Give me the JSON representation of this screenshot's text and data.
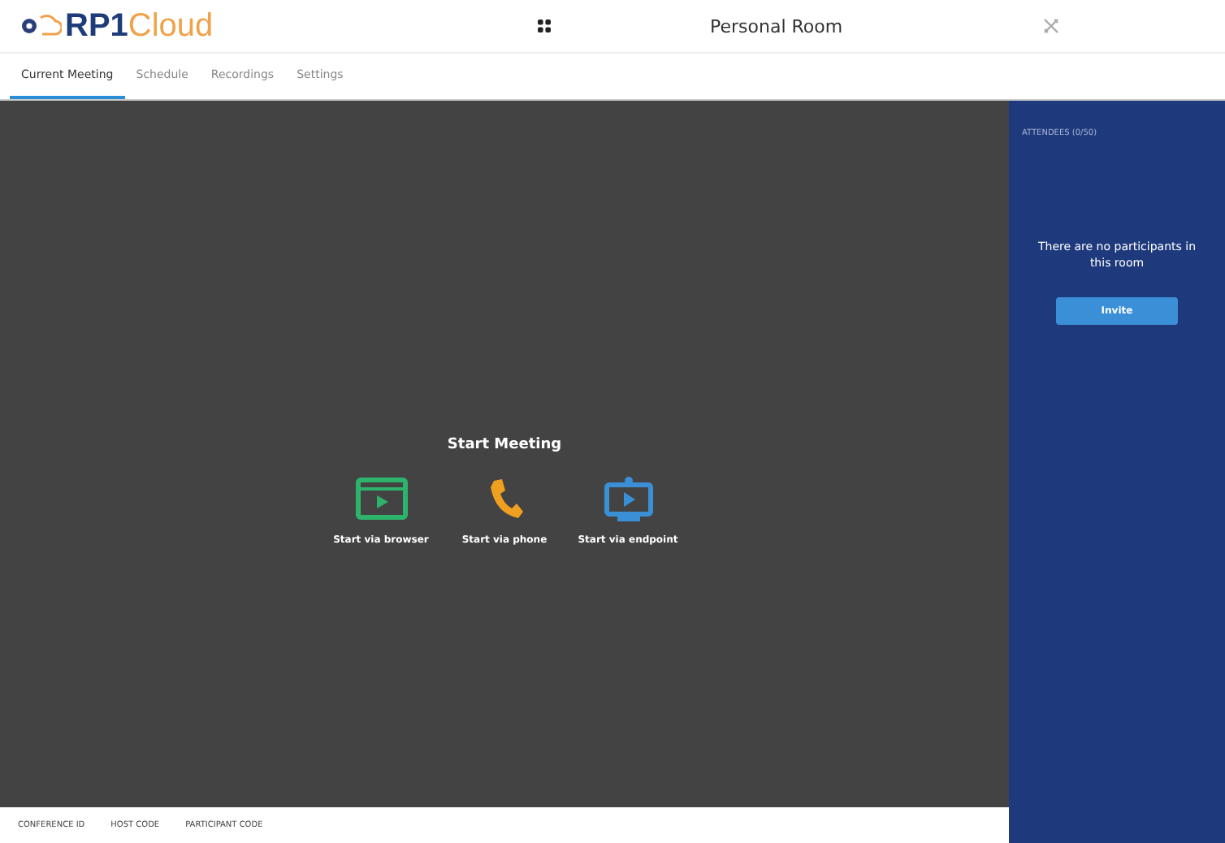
{
  "header": {
    "logo": "**RP1**Cloud",
    "room_title": "Personal Room"
  },
  "tabs": [
    {
      "label": "Current Meeting",
      "selected": true
    },
    {
      "label": "Schedule",
      "selected": false
    },
    {
      "label": "Recordings",
      "selected": false
    },
    {
      "label": "Settings",
      "selected": false
    }
  ],
  "stage": {
    "heading": "Start Meeting",
    "options": [
      {
        "kind": "browser",
        "label": "Start via browser"
      },
      {
        "kind": "phone",
        "label": "Start via phone"
      },
      {
        "kind": "endpoint",
        "label": "Start via endpoint"
      }
    ]
  },
  "footer": [
    "CONFERENCE ID",
    "HOST CODE",
    "PARTICIPANT CODE"
  ],
  "attendees": {
    "heading": "ATTENDEES (0/50)",
    "empty_message": "There are no participants in this room",
    "button": "Invite"
  }
}
